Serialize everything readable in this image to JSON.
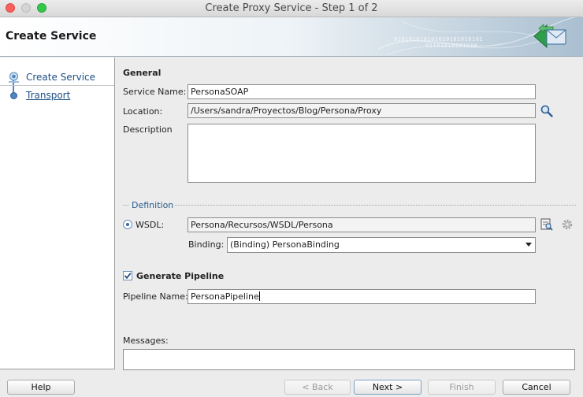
{
  "window": {
    "title": "Create Proxy Service - Step 1 of 2"
  },
  "header": {
    "title": "Create Service",
    "binary_a": "010101010101010101010101",
    "binary_b": "01101010101010"
  },
  "nav": {
    "items": [
      {
        "label": "Create Service",
        "active": true
      },
      {
        "label": "Transport",
        "active": false
      }
    ]
  },
  "general": {
    "section_title": "General",
    "service_name_label": "Service Name:",
    "service_name_value": "PersonaSOAP",
    "location_label": "Location:",
    "location_value": "/Users/sandra/Proyectos/Blog/Persona/Proxy",
    "description_label": "Description",
    "description_value": ""
  },
  "definition": {
    "legend": "Definition",
    "wsdl_label": "WSDL:",
    "wsdl_value": "Persona/Recursos/WSDL/Persona",
    "wsdl_selected": true,
    "binding_label": "Binding:",
    "binding_value": "(Binding) PersonaBinding"
  },
  "pipeline": {
    "generate_label": "Generate Pipeline",
    "generate_checked": true,
    "name_label": "Pipeline Name:",
    "name_value": "PersonaPipeline"
  },
  "messages": {
    "label": "Messages:",
    "value": ""
  },
  "buttons": {
    "help": "Help",
    "back": "< Back",
    "next": "Next >",
    "finish": "Finish",
    "cancel": "Cancel"
  },
  "icons": {
    "location_browse": "magnifier-icon",
    "wsdl_browse": "document-browse-icon",
    "wsdl_settings": "gear-icon",
    "header": "envelope-arrows-icon"
  },
  "colors": {
    "accent": "#1d4f86",
    "definition_legend": "#2b5c8d"
  }
}
